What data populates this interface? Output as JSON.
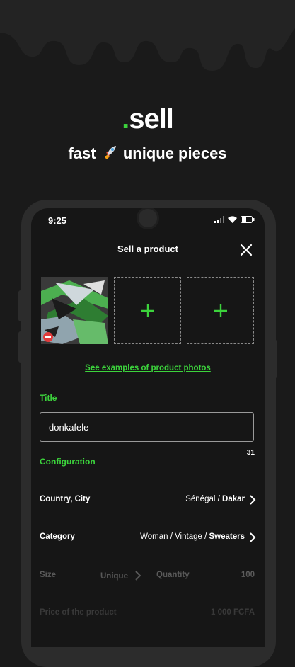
{
  "hero": {
    "brand_dot": ".",
    "brand_name": "sell",
    "tagline_before": "fast",
    "tagline_emoji": "rocket-emoji",
    "tagline_after": "unique pieces"
  },
  "status_bar": {
    "time": "9:25"
  },
  "nav": {
    "title": "Sell a product",
    "close_icon": "close-icon"
  },
  "photos": {
    "add_icon": "plus-icon",
    "remove_icon": "remove-icon"
  },
  "examples_link": "See examples of product photos",
  "title_section": {
    "label": "Title",
    "value": "donkafele",
    "char_count": "31"
  },
  "configuration": {
    "label": "Configuration",
    "location": {
      "label": "Country, City",
      "country": "Sénégal /",
      "city": "Dakar"
    },
    "category": {
      "label": "Category",
      "path": "Woman / Vintage /",
      "leaf": "Sweaters"
    },
    "size": {
      "label": "Size",
      "value": "Unique"
    },
    "quantity": {
      "label": "Quantity",
      "value": "100"
    },
    "price": {
      "label": "Price of the product",
      "value": "1 000 FCFA"
    }
  },
  "colors": {
    "accent": "#3cd33c",
    "background": "#1a1a1a",
    "screen": "#161616"
  }
}
